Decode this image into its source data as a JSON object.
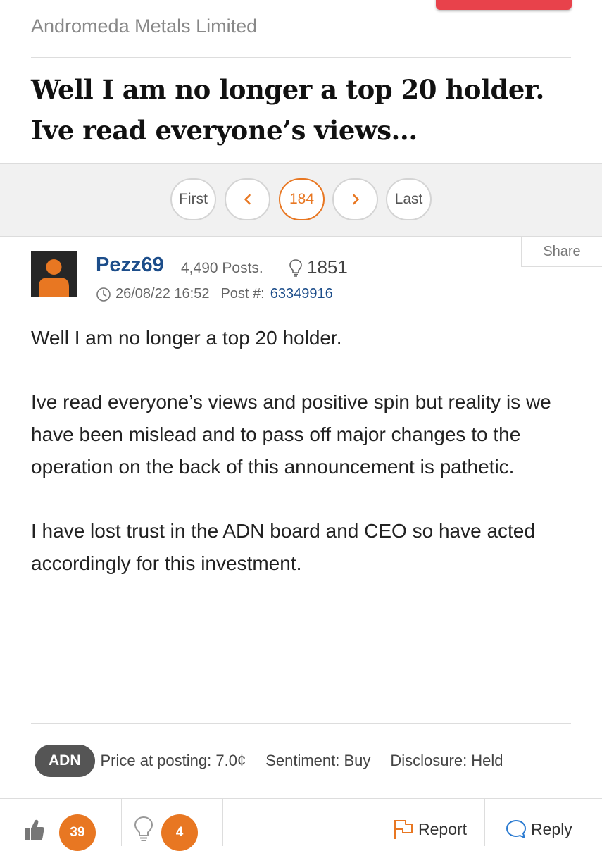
{
  "forum": {
    "company_name": "Andromeda Metals Limited",
    "thread_title": "Well I am no longer a top 20 holder. Ive read everyone’s views..."
  },
  "pagination": {
    "first_label": "First",
    "prev_icon": "chevron-left-icon",
    "current_page": "184",
    "next_icon": "chevron-right-icon",
    "last_label": "Last"
  },
  "post": {
    "share_label": "Share",
    "username": "Pezz69",
    "posts_count": "4,490 Posts.",
    "likes_total": "1851",
    "datetime": "26/08/22 16:52",
    "post_number_label": "Post #:",
    "post_number": "63349916",
    "paragraphs": [
      "Well I am no longer a top 20 holder.",
      "Ive read everyone’s views and positive spin but reality is we have been mislead and to pass off major changes to the operation on the back of this announcement is pathetic.",
      "I have lost trust in the ADN board and CEO so have acted accordingly for this investment."
    ],
    "ticker": "ADN",
    "price_at_posting": "Price at posting: 7.0¢",
    "sentiment": "Sentiment: Buy",
    "disclosure": "Disclosure: Held"
  },
  "actions": {
    "likes_count": "39",
    "ideas_count": "4",
    "report_label": "Report",
    "reply_label": "Reply"
  },
  "colors": {
    "accent_orange": "#e87722",
    "link_blue": "#1c4d8a",
    "top_button_red": "#e8424b"
  }
}
